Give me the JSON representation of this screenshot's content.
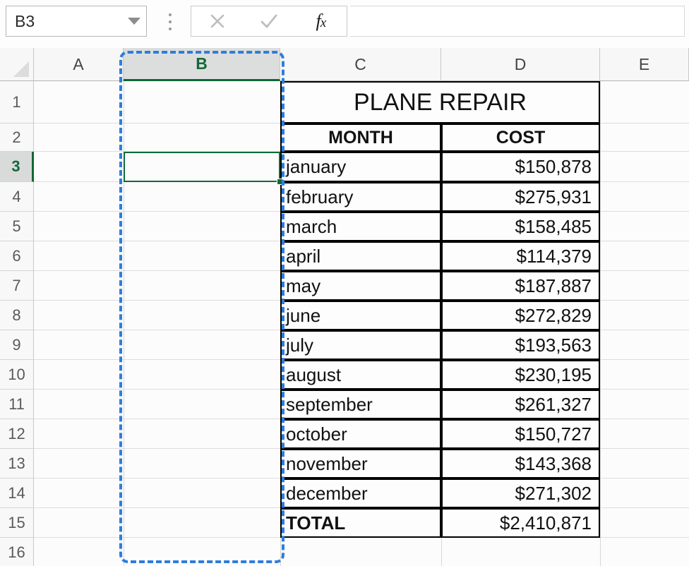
{
  "app": "Microsoft Excel",
  "formula_bar": {
    "name_box_value": "B3",
    "name_box_placeholder": "Name Box",
    "dropdown_icon": "chevron-down-icon",
    "kebab_icon": "more-options-icon",
    "cancel_icon": "cancel-x-icon",
    "enter_icon": "enter-check-icon",
    "function_icon": "fx-insert-function-icon",
    "function_label": "f",
    "function_label_sub": "x",
    "formula_value": "",
    "formula_placeholder": ""
  },
  "grid": {
    "column_headers": [
      "A",
      "B",
      "C",
      "D",
      "E"
    ],
    "selected_column": "B",
    "row_headers": [
      "1",
      "2",
      "3",
      "4",
      "5",
      "6",
      "7",
      "8",
      "9",
      "10",
      "11",
      "12",
      "13",
      "14",
      "15",
      "16"
    ],
    "selected_row": "3",
    "active_cell": "B3",
    "select_all_icon": "select-all-corner-icon",
    "marching_ants_range": "B:B"
  },
  "report": {
    "title": "PLANE REPAIR",
    "headers": {
      "month": "MONTH",
      "cost": "COST"
    },
    "rows": [
      {
        "month": "january",
        "cost": "$150,878"
      },
      {
        "month": "february",
        "cost": "$275,931"
      },
      {
        "month": "march",
        "cost": "$158,485"
      },
      {
        "month": "april",
        "cost": "$114,379"
      },
      {
        "month": "may",
        "cost": "$187,887"
      },
      {
        "month": "june",
        "cost": "$272,829"
      },
      {
        "month": "july",
        "cost": "$193,563"
      },
      {
        "month": "august",
        "cost": "$230,195"
      },
      {
        "month": "september",
        "cost": "$261,327"
      },
      {
        "month": "october",
        "cost": "$150,727"
      },
      {
        "month": "november",
        "cost": "$143,368"
      },
      {
        "month": "december",
        "cost": "$271,302"
      }
    ],
    "total": {
      "label": "TOTAL",
      "value": "$2,410,871"
    }
  },
  "colors": {
    "selection_green": "#0f6b39",
    "marching_ants_blue": "#2e7ddb",
    "header_gray": "#f7f7f7",
    "gridline": "#dddddd",
    "table_border": "#000000"
  }
}
